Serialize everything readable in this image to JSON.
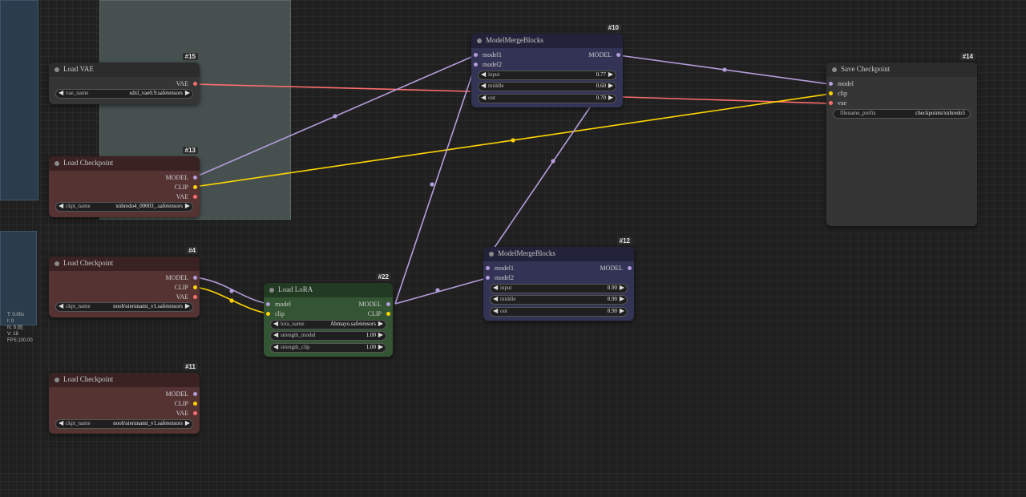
{
  "colors": {
    "model": "#b39ddb",
    "clip": "#ffd500",
    "vae": "#ff6e6e",
    "checkpoint_body": "#553333",
    "checkpoint_title": "#3a2222",
    "lora_body": "#335533",
    "lora_title": "#223a22",
    "merge_body": "#333355",
    "merge_title": "#22223a",
    "neutral_body": "#353535",
    "neutral_title": "#2c2c2c"
  },
  "stats": {
    "lines": [
      "T: 0.00s",
      "I: 0",
      "N: 8 [8]",
      "V: 18",
      "FPS:100.00"
    ]
  },
  "nodes": {
    "load_vae": {
      "id": "#15",
      "title": "Load VAE",
      "outputs": [
        "VAE"
      ],
      "widgets": [
        {
          "label": "vae_name",
          "value": "sdxl_vae0.9.safetensors"
        }
      ]
    },
    "load_checkpoint_13": {
      "id": "#13",
      "title": "Load Checkpoint",
      "outputs": [
        "MODEL",
        "CLIP",
        "VAE"
      ],
      "widgets": [
        {
          "label": "ckpt_name",
          "value": "xnhredo4_00003_.safetensors"
        }
      ]
    },
    "load_checkpoint_4": {
      "id": "#4",
      "title": "Load Checkpoint",
      "outputs": [
        "MODEL",
        "CLIP",
        "VAE"
      ],
      "widgets": [
        {
          "label": "ckpt_name",
          "value": "noob\\sierunami_v1.safetensors"
        }
      ]
    },
    "load_checkpoint_11": {
      "id": "#11",
      "title": "Load Checkpoint",
      "outputs": [
        "MODEL",
        "CLIP",
        "VAE"
      ],
      "widgets": [
        {
          "label": "ckpt_name",
          "value": "noob\\sierunami_v1.safetensors"
        }
      ]
    },
    "load_lora": {
      "id": "#22",
      "title": "Load LoRA",
      "inputs": [
        "model",
        "clip"
      ],
      "outputs": [
        "MODEL",
        "CLIP"
      ],
      "widgets": [
        {
          "label": "lora_name",
          "value": "Abmayo.safetensors"
        },
        {
          "label": "strength_model",
          "value": "1.00"
        },
        {
          "label": "strength_clip",
          "value": "1.00"
        }
      ]
    },
    "merge_10": {
      "id": "#10",
      "title": "ModelMergeBlocks",
      "inputs": [
        "model1",
        "model2"
      ],
      "outputs": [
        "MODEL"
      ],
      "widgets": [
        {
          "label": "input",
          "value": "0.77"
        },
        {
          "label": "middle",
          "value": "0.60"
        },
        {
          "label": "out",
          "value": "0.70"
        }
      ]
    },
    "merge_12": {
      "id": "#12",
      "title": "ModelMergeBlocks",
      "inputs": [
        "model1",
        "model2"
      ],
      "outputs": [
        "MODEL"
      ],
      "widgets": [
        {
          "label": "input",
          "value": "0.90"
        },
        {
          "label": "middle",
          "value": "0.90"
        },
        {
          "label": "out",
          "value": "0.90"
        }
      ]
    },
    "save_checkpoint": {
      "id": "#14",
      "title": "Save Checkpoint",
      "inputs": [
        "model",
        "clip",
        "vae"
      ],
      "widgets": [
        {
          "label": "filename_prefix",
          "value": "checkpoints/xnhredo5"
        }
      ]
    }
  }
}
